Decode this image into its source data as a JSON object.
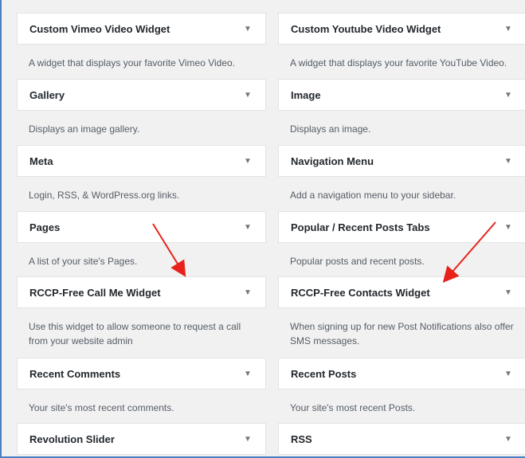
{
  "widgets": {
    "left": [
      {
        "title": "Custom Vimeo Video Widget",
        "desc": "A widget that displays your favorite Vimeo Video."
      },
      {
        "title": "Gallery",
        "desc": "Displays an image gallery."
      },
      {
        "title": "Meta",
        "desc": "Login, RSS, & WordPress.org links."
      },
      {
        "title": "Pages",
        "desc": "A list of your site's Pages."
      },
      {
        "title": "RCCP-Free Call Me Widget",
        "desc": "Use this widget to allow someone to request a call from your website admin"
      },
      {
        "title": "Recent Comments",
        "desc": "Your site's most recent comments."
      },
      {
        "title": "Revolution Slider",
        "desc": ""
      }
    ],
    "right": [
      {
        "title": "Custom Youtube Video Widget",
        "desc": "A widget that displays your favorite YouTube Video."
      },
      {
        "title": "Image",
        "desc": "Displays an image."
      },
      {
        "title": "Navigation Menu",
        "desc": "Add a navigation menu to your sidebar."
      },
      {
        "title": "Popular / Recent Posts Tabs",
        "desc": "Popular posts and recent posts."
      },
      {
        "title": "RCCP-Free Contacts Widget",
        "desc": "When signing up for new Post Notifications also offer SMS messages."
      },
      {
        "title": "Recent Posts",
        "desc": "Your site's most recent Posts."
      },
      {
        "title": "RSS",
        "desc": ""
      }
    ]
  },
  "icons": {
    "expand": "▼"
  },
  "colors": {
    "annotation_arrow": "#e8221b"
  }
}
